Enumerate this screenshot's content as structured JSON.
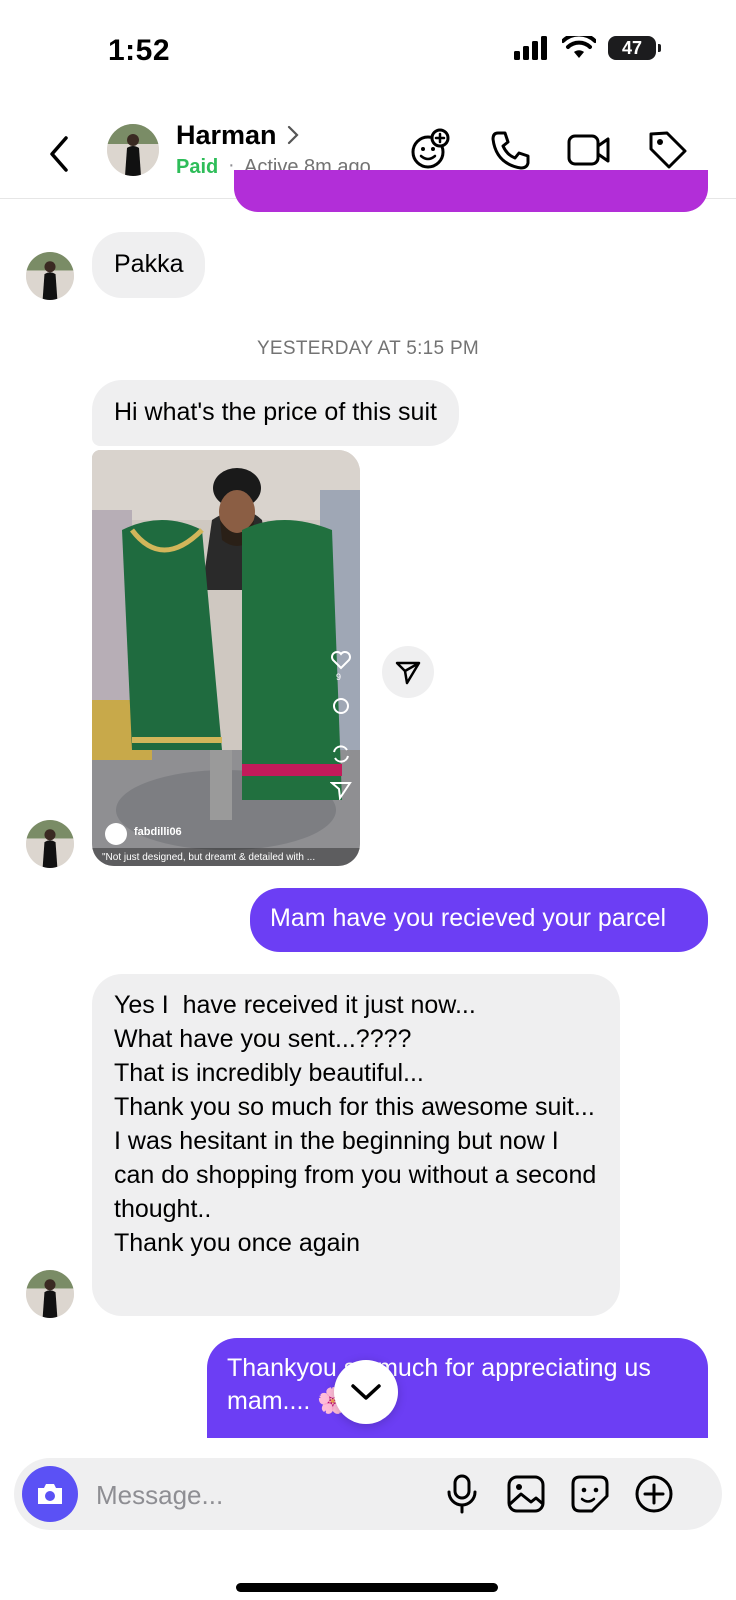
{
  "status": {
    "time": "1:52",
    "battery": "47"
  },
  "header": {
    "name": "Harman",
    "paid": "Paid",
    "separator": "·",
    "active": "Active 8m ago"
  },
  "messages": {
    "pakka": "Pakka",
    "timestamp": "YESTERDAY AT 5:15 PM",
    "price_question": "Hi what's the price of this suit",
    "reel": {
      "account": "fabdilli06",
      "caption": "\"Not just designed, but dreamt & detailed with ...",
      "likes": "9"
    },
    "parcel": "Mam have you recieved your parcel",
    "reply_lines": [
      "Yes I  have received it just now...",
      "What have you sent...????",
      "That is incredibly beautiful...",
      "Thank you so much for this awesome suit...",
      "I was hesitant in the beginning but now I can do shopping from you without a second thought..",
      "Thank you once again"
    ],
    "thanks": "Thankyou so much for appreciating us mam.... 🌸"
  },
  "composer": {
    "placeholder": "Message..."
  },
  "colors": {
    "outgoing": "#6c3ef4",
    "incoming": "#efeff0",
    "paid": "#2ebd59",
    "camera": "#5b51f5"
  },
  "icons": [
    "back-icon",
    "chevron-right-icon",
    "sticker-plus-icon",
    "phone-icon",
    "video-icon",
    "tag-icon",
    "share-icon",
    "chevron-down-icon",
    "camera-icon",
    "microphone-icon",
    "gallery-icon",
    "sticker-icon",
    "plus-circle-icon",
    "signal-icon",
    "wifi-icon",
    "battery-icon"
  ]
}
